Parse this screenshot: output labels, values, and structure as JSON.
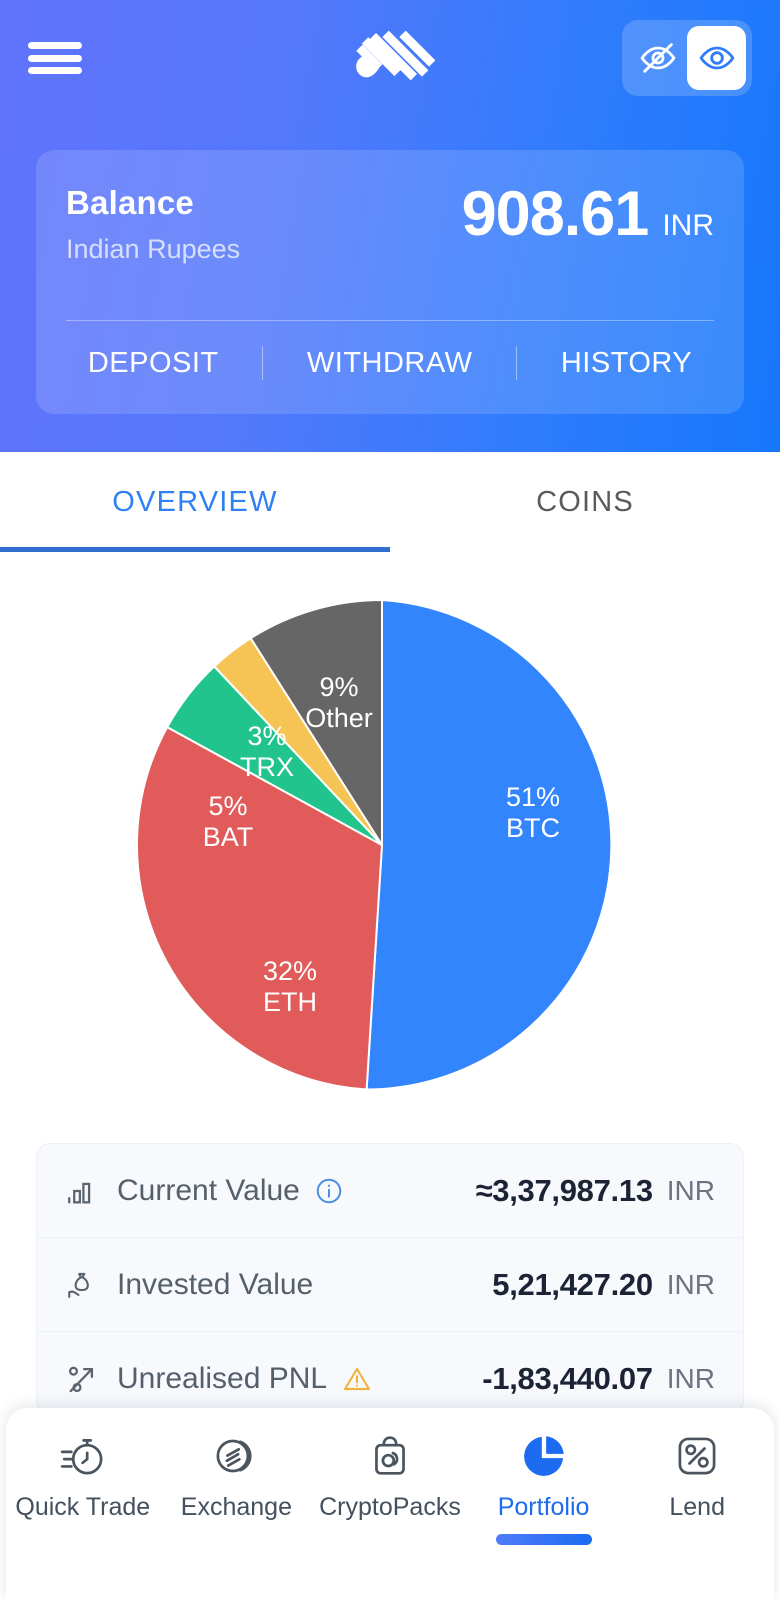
{
  "header": {
    "menu_icon": "hamburger-menu-icon",
    "logo_icon": "app-logo-icon",
    "visibility_toggle": {
      "hidden_icon": "eye-off-icon",
      "visible_icon": "eye-icon",
      "selected": "visible"
    }
  },
  "balance": {
    "title": "Balance",
    "subtitle": "Indian Rupees",
    "amount": "908.61",
    "currency": "INR",
    "actions": [
      {
        "label": "DEPOSIT"
      },
      {
        "label": "WITHDRAW"
      },
      {
        "label": "HISTORY"
      }
    ]
  },
  "tabs": [
    {
      "label": "OVERVIEW",
      "active": true
    },
    {
      "label": "COINS",
      "active": false
    }
  ],
  "chart_data": {
    "type": "pie",
    "title": "",
    "labels": [
      "BTC",
      "ETH",
      "BAT",
      "TRX",
      "Other"
    ],
    "values": [
      51,
      32,
      5,
      3,
      9
    ],
    "unit": "%",
    "colors": [
      "#3385FD",
      "#E15B5B",
      "#22C48D",
      "#F5C455",
      "#666666"
    ],
    "legend": "labels-on-slices",
    "slice_labels": [
      {
        "percent": "51%",
        "name": "BTC"
      },
      {
        "percent": "32%",
        "name": "ETH"
      },
      {
        "percent": "5%",
        "name": "BAT"
      },
      {
        "percent": "3%",
        "name": "TRX"
      },
      {
        "percent": "9%",
        "name": "Other"
      }
    ]
  },
  "stats": {
    "rows": [
      {
        "icon": "bar-chart-icon",
        "label": "Current Value",
        "badge_icon": "info-icon",
        "value": "≈3,37,987.13",
        "currency": "INR"
      },
      {
        "icon": "hand-money-bag-icon",
        "label": "Invested Value",
        "badge_icon": "",
        "value": "5,21,427.20",
        "currency": "INR"
      },
      {
        "icon": "percent-arrow-icon",
        "label": "Unrealised PNL",
        "badge_icon": "warning-icon",
        "value": "-1,83,440.07",
        "currency": "INR"
      }
    ]
  },
  "bottom_nav": {
    "items": [
      {
        "label": "Quick Trade",
        "icon": "stopwatch-icon",
        "active": false
      },
      {
        "label": "Exchange",
        "icon": "exchange-coins-icon",
        "active": false
      },
      {
        "label": "CryptoPacks",
        "icon": "crypto-bag-icon",
        "active": false
      },
      {
        "label": "Portfolio",
        "icon": "pie-chart-icon",
        "active": true
      },
      {
        "label": "Lend",
        "icon": "percent-box-icon",
        "active": false
      }
    ]
  },
  "colors": {
    "brand_blue": "#2F80F5",
    "header_gradient_start": "#6073FB",
    "header_gradient_end": "#1677FB",
    "active_nav": "#1C6BF0",
    "warning": "#F2B33D",
    "info": "#4A90E2"
  }
}
